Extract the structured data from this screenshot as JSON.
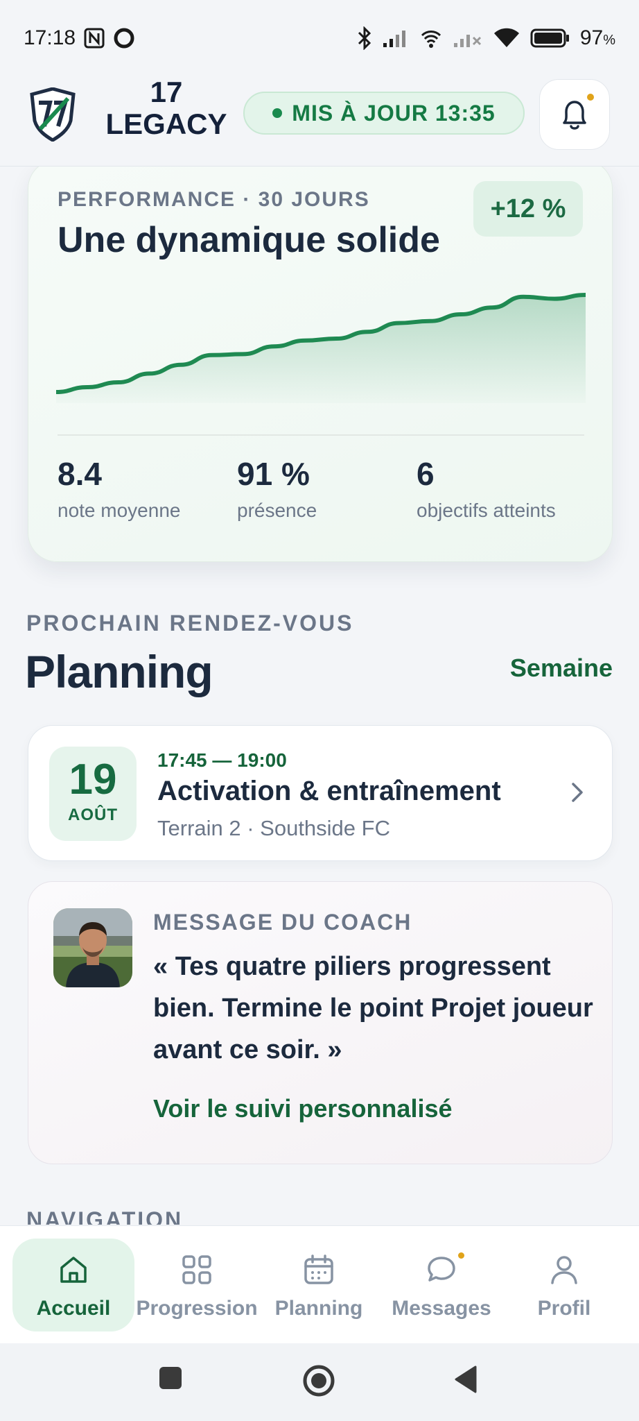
{
  "status_bar": {
    "time": "17:18",
    "battery_percent": "97",
    "battery_suffix": "%",
    "icons": [
      "nfc-icon",
      "circle-icon",
      "bluetooth-icon",
      "signal-icon",
      "hotspot-icon",
      "signal-no-service-icon",
      "wifi-icon",
      "battery-icon"
    ]
  },
  "header": {
    "logo_icon": "shield-logo-icon",
    "brand_line1": "17",
    "brand_line2": "LEGACY",
    "update_label": "MIS À JOUR 13:35",
    "notification_icon": "bell-icon",
    "has_unread": true
  },
  "performance": {
    "kicker": "PERFORMANCE · 30 JOURS",
    "title": "Une dynamique solide",
    "badge": "+12 %",
    "trend_values": [
      0,
      0.05,
      0.1,
      0.19,
      0.28,
      0.38,
      0.39,
      0.47,
      0.53,
      0.55,
      0.62,
      0.71,
      0.73,
      0.8,
      0.87,
      0.98,
      0.96,
      1
    ],
    "stats": [
      {
        "value": "8.4",
        "label": "note moyenne"
      },
      {
        "value": "91 %",
        "label": "présence"
      },
      {
        "value": "6",
        "label": "objectifs atteints"
      }
    ]
  },
  "planning": {
    "kicker": "PROCHAIN RENDEZ-VOUS",
    "title": "Planning",
    "link": "Semaine",
    "event": {
      "day": "19",
      "month": "AOÛT",
      "time": "17:45 — 19:00",
      "title": "Activation & entraînement",
      "location": "Terrain 2 · Southside FC"
    }
  },
  "coach": {
    "kicker": "MESSAGE DU COACH",
    "quote": "« Tes quatre piliers progressent bien. Termine le point Projet joueur avant ce soir. »",
    "link": "Voir le suivi personnalisé"
  },
  "navigation_section": {
    "kicker": "NAVIGATION"
  },
  "bottom_nav": {
    "items": [
      {
        "label": "Accueil",
        "icon": "home-icon",
        "active": true
      },
      {
        "label": "Progression",
        "icon": "grid-icon",
        "active": false
      },
      {
        "label": "Planning",
        "icon": "calendar-icon",
        "active": false
      },
      {
        "label": "Messages",
        "icon": "chat-icon",
        "active": false,
        "badge": true
      },
      {
        "label": "Profil",
        "icon": "user-icon",
        "active": false
      }
    ]
  },
  "colors": {
    "accent_green": "#16643b",
    "pill_bg": "#e3f4ea",
    "text_dark": "#1c2a3e",
    "text_muted": "#6b7688",
    "notification_dot": "#e0a31a"
  }
}
